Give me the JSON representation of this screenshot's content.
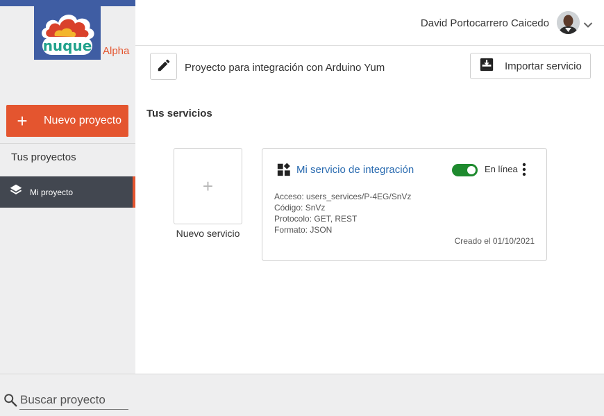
{
  "app": {
    "logo_text": "nuque",
    "version_badge": "Alpha"
  },
  "sidebar": {
    "new_project_label": "Nuevo proyecto",
    "projects_heading": "Tus proyectos",
    "projects": [
      {
        "label": "Mi proyecto",
        "active": true
      }
    ]
  },
  "search": {
    "placeholder": "Buscar proyecto"
  },
  "header": {
    "user_name": "David Portocarrero Caicedo"
  },
  "project": {
    "title": "Proyecto para integración con Arduino Yum",
    "import_label": "Importar servicio"
  },
  "services": {
    "heading": "Tus servicios",
    "new_service_label": "Nuevo servicio",
    "items": [
      {
        "name": "Mi servicio de integración",
        "status": "En línea",
        "online": true,
        "access": "Acceso: users_services/P-4EG/SnVz",
        "code": "Código: SnVz",
        "protocol": "Protocolo: GET, REST",
        "format": "Formato: JSON",
        "created": "Creado el 01/10/2021"
      }
    ]
  },
  "colors": {
    "brand_blue": "#3f5da3",
    "accent_orange": "#e4552f",
    "sidebar_active": "#424750",
    "link_blue": "#2a6bb0",
    "status_green": "#1e8a2e"
  },
  "icons": {
    "plus": "plus-icon",
    "layers": "layers-icon",
    "search": "search-icon",
    "edit": "pencil-icon",
    "import": "import-icon",
    "widgets": "widgets-icon",
    "more": "more-vertical-icon",
    "chevron": "chevron-down-icon"
  }
}
